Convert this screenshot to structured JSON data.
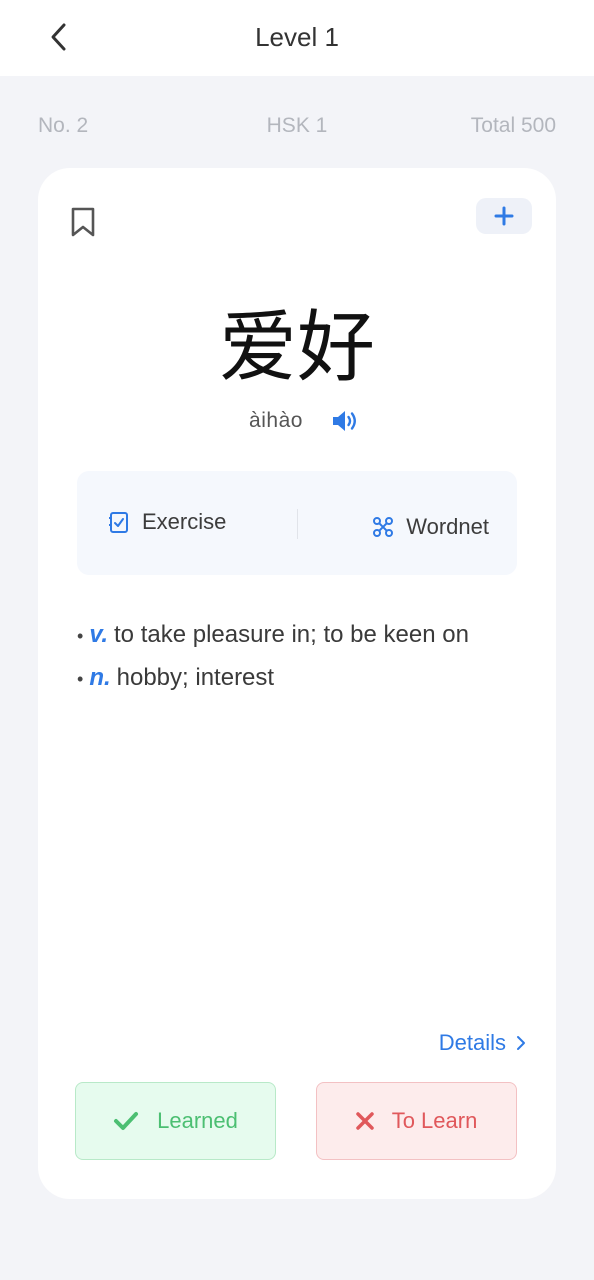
{
  "header": {
    "title": "Level 1"
  },
  "stats": {
    "number": "No. 2",
    "level": "HSK 1",
    "total": "Total 500"
  },
  "word": {
    "hanzi": "爱好",
    "pinyin": "àihào"
  },
  "tools": {
    "exercise_label": "Exercise",
    "wordnet_label": "Wordnet"
  },
  "definitions": [
    {
      "pos": "v.",
      "text": "to take pleasure in; to be keen on"
    },
    {
      "pos": "n.",
      "text": "hobby; interest"
    }
  ],
  "details_label": "Details",
  "actions": {
    "learned_label": "Learned",
    "to_learn_label": "To Learn"
  },
  "colors": {
    "accent": "#2f7ae5",
    "learned": "#4cbf72",
    "to_learn": "#e0585b"
  },
  "icons": {
    "back": "chevron-left-icon",
    "bookmark": "bookmark-icon",
    "add": "plus-icon",
    "audio": "speaker-icon",
    "exercise": "checklist-icon",
    "wordnet": "network-icon",
    "details": "chevron-right-icon",
    "learned": "check-icon",
    "to_learn": "cross-icon"
  }
}
